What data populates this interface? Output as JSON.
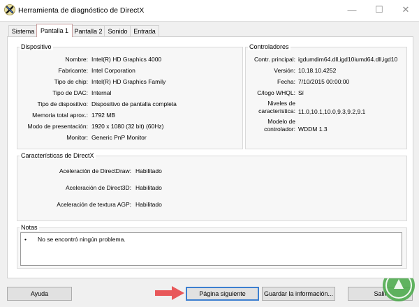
{
  "window": {
    "title": "Herramienta de diagnóstico de DirectX",
    "minimize_glyph": "—",
    "maximize_glyph": "☐",
    "close_glyph": "✕"
  },
  "tabs": [
    {
      "label": "Sistema",
      "active": false
    },
    {
      "label": "Pantalla 1",
      "active": true
    },
    {
      "label": "Pantalla 2",
      "active": false
    },
    {
      "label": "Sonido",
      "active": false
    },
    {
      "label": "Entrada",
      "active": false
    }
  ],
  "device": {
    "title": "Dispositivo",
    "rows": [
      {
        "label": "Nombre:",
        "value": "Intel(R) HD Graphics 4000"
      },
      {
        "label": "Fabricante:",
        "value": "Intel Corporation"
      },
      {
        "label": "Tipo de chip:",
        "value": "Intel(R) HD Graphics Family"
      },
      {
        "label": "Tipo de DAC:",
        "value": "Internal"
      },
      {
        "label": "Tipo de dispositivo:",
        "value": "Dispositivo de pantalla completa"
      },
      {
        "label": "Memoria total aprox.:",
        "value": "1792 MB"
      },
      {
        "label": "Modo de presentación:",
        "value": "1920 x 1080 (32 bit) (60Hz)"
      },
      {
        "label": "Monitor:",
        "value": "Generic PnP Monitor"
      }
    ]
  },
  "drivers": {
    "title": "Controladores",
    "rows": [
      {
        "label": "Contr. principal:",
        "value": "igdumdim64.dll,igd10iumd64.dll,igd10"
      },
      {
        "label": "Versión:",
        "value": "10.18.10.4252"
      },
      {
        "label": "Fecha:",
        "value": "7/10/2015 00:00:00"
      },
      {
        "label": "C/logo WHQL:",
        "value": "Sí"
      },
      {
        "label": "Niveles de característica:",
        "value": "11.0,10.1,10.0,9.3,9.2,9.1"
      },
      {
        "label": "Modelo de controlador:",
        "value": "WDDM 1.3"
      }
    ]
  },
  "directx_features": {
    "title": "Características de DirectX",
    "rows": [
      {
        "label": "Aceleración de DirectDraw:",
        "value": "Habilitado"
      },
      {
        "label": "Aceleración de Direct3D:",
        "value": "Habilitado"
      },
      {
        "label": "Aceleración de textura AGP:",
        "value": "Habilitado"
      }
    ]
  },
  "notes": {
    "title": "Notas",
    "items": [
      "No se encontró ningún problema."
    ]
  },
  "buttons": {
    "help": "Ayuda",
    "next_page": "Página siguiente",
    "save_info": "Guardar la información...",
    "exit": "Salir"
  },
  "colors": {
    "annotation_arrow": "#e8585a",
    "default_button_border": "#3c7fd0",
    "watermark": "#46a846"
  }
}
